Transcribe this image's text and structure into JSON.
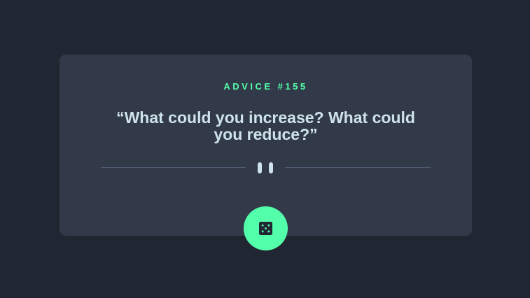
{
  "advice": {
    "label_prefix": "ADVICE #",
    "number": "155",
    "quote": "“What could you increase? What could you reduce?”"
  },
  "divider": {
    "icon": "pause-icon"
  },
  "action": {
    "icon": "dice-icon"
  },
  "colors": {
    "background": "#202632",
    "card": "#323a49",
    "accent": "#53ffaa",
    "text": "#cee3e9",
    "divider": "#4f5d74"
  }
}
